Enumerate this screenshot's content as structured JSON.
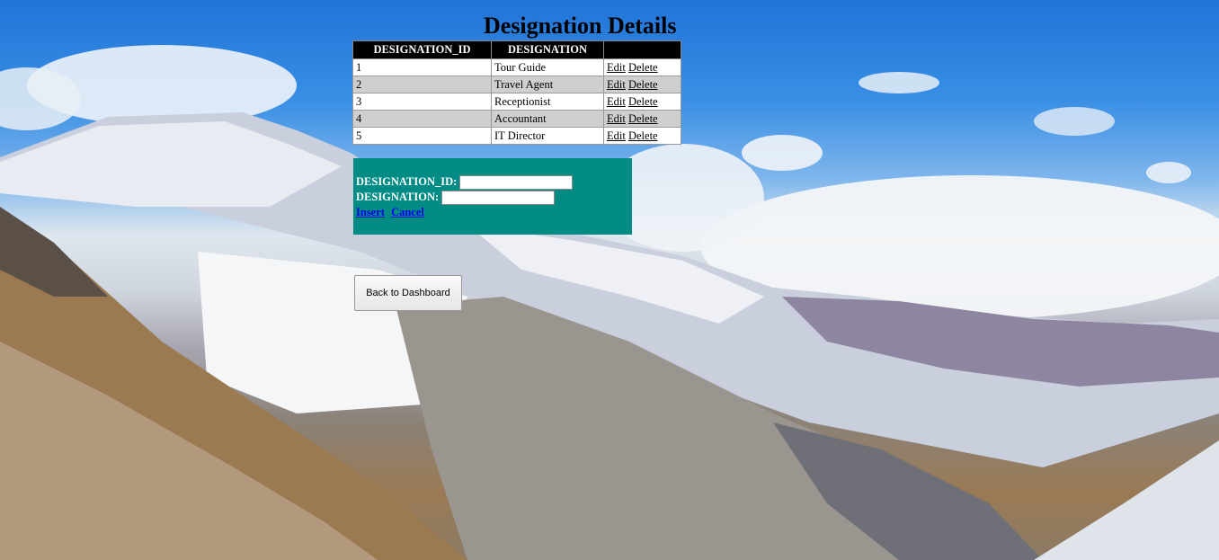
{
  "page": {
    "title": "Designation Details"
  },
  "table": {
    "headers": [
      "DESIGNATION_ID",
      "DESIGNATION",
      ""
    ],
    "edit_label": "Edit",
    "delete_label": "Delete",
    "rows": [
      {
        "id": "1",
        "designation": "Tour Guide"
      },
      {
        "id": "2",
        "designation": "Travel Agent"
      },
      {
        "id": "3",
        "designation": "Receptionist"
      },
      {
        "id": "4",
        "designation": "Accountant"
      },
      {
        "id": "5",
        "designation": "IT Director"
      }
    ]
  },
  "form": {
    "id_label": "DESIGNATION_ID:",
    "id_value": "",
    "designation_label": "DESIGNATION:",
    "designation_value": "",
    "insert_label": "Insert",
    "cancel_label": "Cancel"
  },
  "back_button": {
    "label": "Back to Dashboard"
  },
  "colors": {
    "header_bg": "#000000",
    "alt_row": "#cfcfcf",
    "panel_bg": "#008b85",
    "link": "#0000ee"
  }
}
